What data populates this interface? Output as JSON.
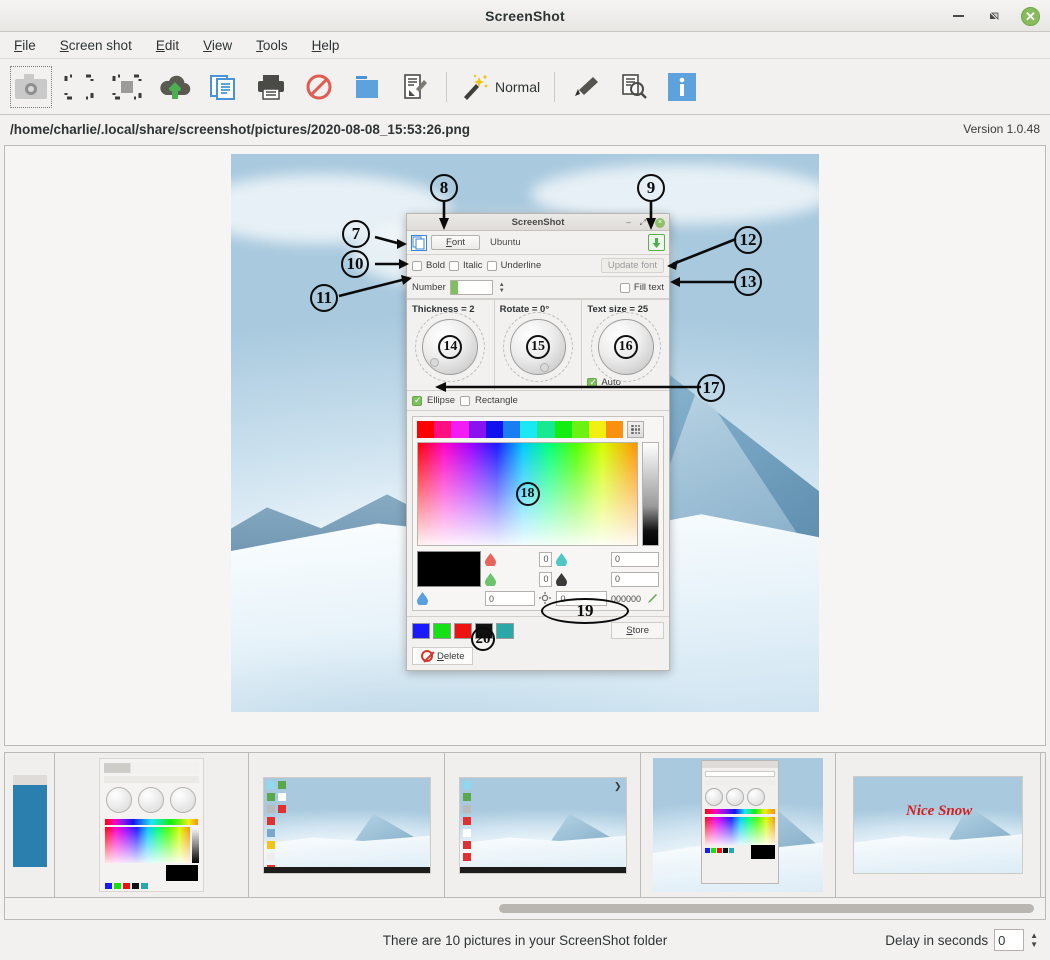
{
  "window": {
    "title": "ScreenShot",
    "minimize_icon": "minimize-icon",
    "restore_icon": "restore-icon",
    "close_icon": "close-icon",
    "close_glyph": "✕"
  },
  "menubar": {
    "items": [
      {
        "label": "File",
        "mnemonic": "F",
        "rest": "ile"
      },
      {
        "label": "Screen shot",
        "mnemonic": "S",
        "rest": "creen shot"
      },
      {
        "label": "Edit",
        "mnemonic": "E",
        "rest": "dit"
      },
      {
        "label": "View",
        "mnemonic": "V",
        "rest": "iew"
      },
      {
        "label": "Tools",
        "mnemonic": "T",
        "rest": "ools"
      },
      {
        "label": "Help",
        "mnemonic": "H",
        "rest": "elp"
      }
    ]
  },
  "toolbar": {
    "buttons": [
      {
        "name": "capture-fullscreen-icon",
        "tooltip": "Take screenshot"
      },
      {
        "name": "capture-region-icon",
        "tooltip": "Capture region"
      },
      {
        "name": "capture-window-icon",
        "tooltip": "Capture window"
      },
      {
        "name": "upload-icon",
        "tooltip": "Upload"
      },
      {
        "name": "copy-icon",
        "tooltip": "Copy"
      },
      {
        "name": "print-icon",
        "tooltip": "Print"
      },
      {
        "name": "cancel-icon",
        "tooltip": "Cancel"
      },
      {
        "name": "folder-icon",
        "tooltip": "Open folder"
      },
      {
        "name": "edit-document-icon",
        "tooltip": "Edit"
      },
      {
        "name": "magic-wand-icon",
        "tooltip": "Effect"
      },
      {
        "name": "pencil-icon",
        "tooltip": "Draw"
      },
      {
        "name": "preview-icon",
        "tooltip": "Preview"
      },
      {
        "name": "info-icon",
        "tooltip": "Information"
      }
    ],
    "mode_label": "Normal"
  },
  "pathbar": {
    "path": "/home/charlie/.local/share/screenshot/pictures/2020-08-08_15:53:26.png",
    "version": "Version 1.0.48"
  },
  "dialog": {
    "title": "ScreenShot",
    "minimize_glyph": "–",
    "restore_glyph": "⤢",
    "close_glyph": "×",
    "copy_icon": "copy-style-icon",
    "font_button": "Font",
    "font_mnemonic": "F",
    "font_rest": "ont",
    "font_name": "Ubuntu",
    "save_icon": "save-down-icon",
    "bold_label": "Bold",
    "italic_label": "Italic",
    "underline_label": "Underline",
    "update_font_label": "Update font",
    "number_label": "Number",
    "number_value": "",
    "fill_text_label": "Fill text",
    "thickness_label": "Thickness = 2",
    "rotate_label": "Rotate = 0°",
    "textsize_label": "Text size = 25",
    "auto_label": "Auto",
    "ellipse_label": "Ellipse",
    "rectangle_label": "Rectangle",
    "swatches": [
      "#ff0000",
      "#ff0f7f",
      "#f41cf4",
      "#8a12f0",
      "#1212ef",
      "#1a7ef2",
      "#1ae8f2",
      "#16e98f",
      "#12ee12",
      "#6af312",
      "#f2ef12",
      "#f99010"
    ],
    "grid_icon": "color-grid-icon",
    "rgb_fields": [
      {
        "icon": "red-drop-icon",
        "value": "0"
      },
      {
        "icon": "cyan-drop-icon",
        "value": "0"
      },
      {
        "icon": "green-drop-icon",
        "value": "0"
      },
      {
        "icon": "black-drop-icon",
        "value": "0"
      },
      {
        "icon": "blue-drop-icon",
        "value": "0"
      },
      {
        "icon": "brightness-icon",
        "value": "0"
      }
    ],
    "hex_value": "000000",
    "eyedropper_icon": "eyedropper-icon",
    "preview_color": "#000000",
    "stored_colors": [
      "#1a1aff",
      "#17e017",
      "#ee1111",
      "#111111",
      "#2aa8a8"
    ],
    "store_label": "Store",
    "store_mnemonic": "S",
    "store_rest": "tore",
    "delete_label": "Delete",
    "delete_mnemonic": "D",
    "delete_rest": "elete",
    "delete_icon": "no-entry-icon"
  },
  "annotations": [
    {
      "id": "7",
      "label": "7"
    },
    {
      "id": "8",
      "label": "8"
    },
    {
      "id": "9",
      "label": "9"
    },
    {
      "id": "10",
      "label": "10"
    },
    {
      "id": "11",
      "label": "11"
    },
    {
      "id": "12",
      "label": "12"
    },
    {
      "id": "13",
      "label": "13"
    },
    {
      "id": "14",
      "label": "14"
    },
    {
      "id": "15",
      "label": "15"
    },
    {
      "id": "16",
      "label": "16"
    },
    {
      "id": "17",
      "label": "17"
    },
    {
      "id": "18",
      "label": "18"
    },
    {
      "id": "19",
      "label": "19"
    },
    {
      "id": "20",
      "label": "20"
    }
  ],
  "thumbnails": {
    "count": 6,
    "items": [
      {
        "name": "thumbnail-1",
        "kind": "partial-blue"
      },
      {
        "name": "thumbnail-2",
        "kind": "dialog-closeup"
      },
      {
        "name": "thumbnail-3",
        "kind": "desktop-snow"
      },
      {
        "name": "thumbnail-4",
        "kind": "desktop-snow"
      },
      {
        "name": "thumbnail-5",
        "kind": "annotated-dialog"
      },
      {
        "name": "thumbnail-6",
        "kind": "red-text-snow"
      }
    ]
  },
  "statusbar": {
    "message": "There are 10 pictures in your ScreenShot folder",
    "delay_label": "Delay in seconds",
    "delay_value": "0"
  },
  "colors": {
    "accent_blue": "#5da2dc",
    "green": "#4aa02c",
    "red": "#d7342a",
    "window_bg": "#f2f1f0"
  }
}
